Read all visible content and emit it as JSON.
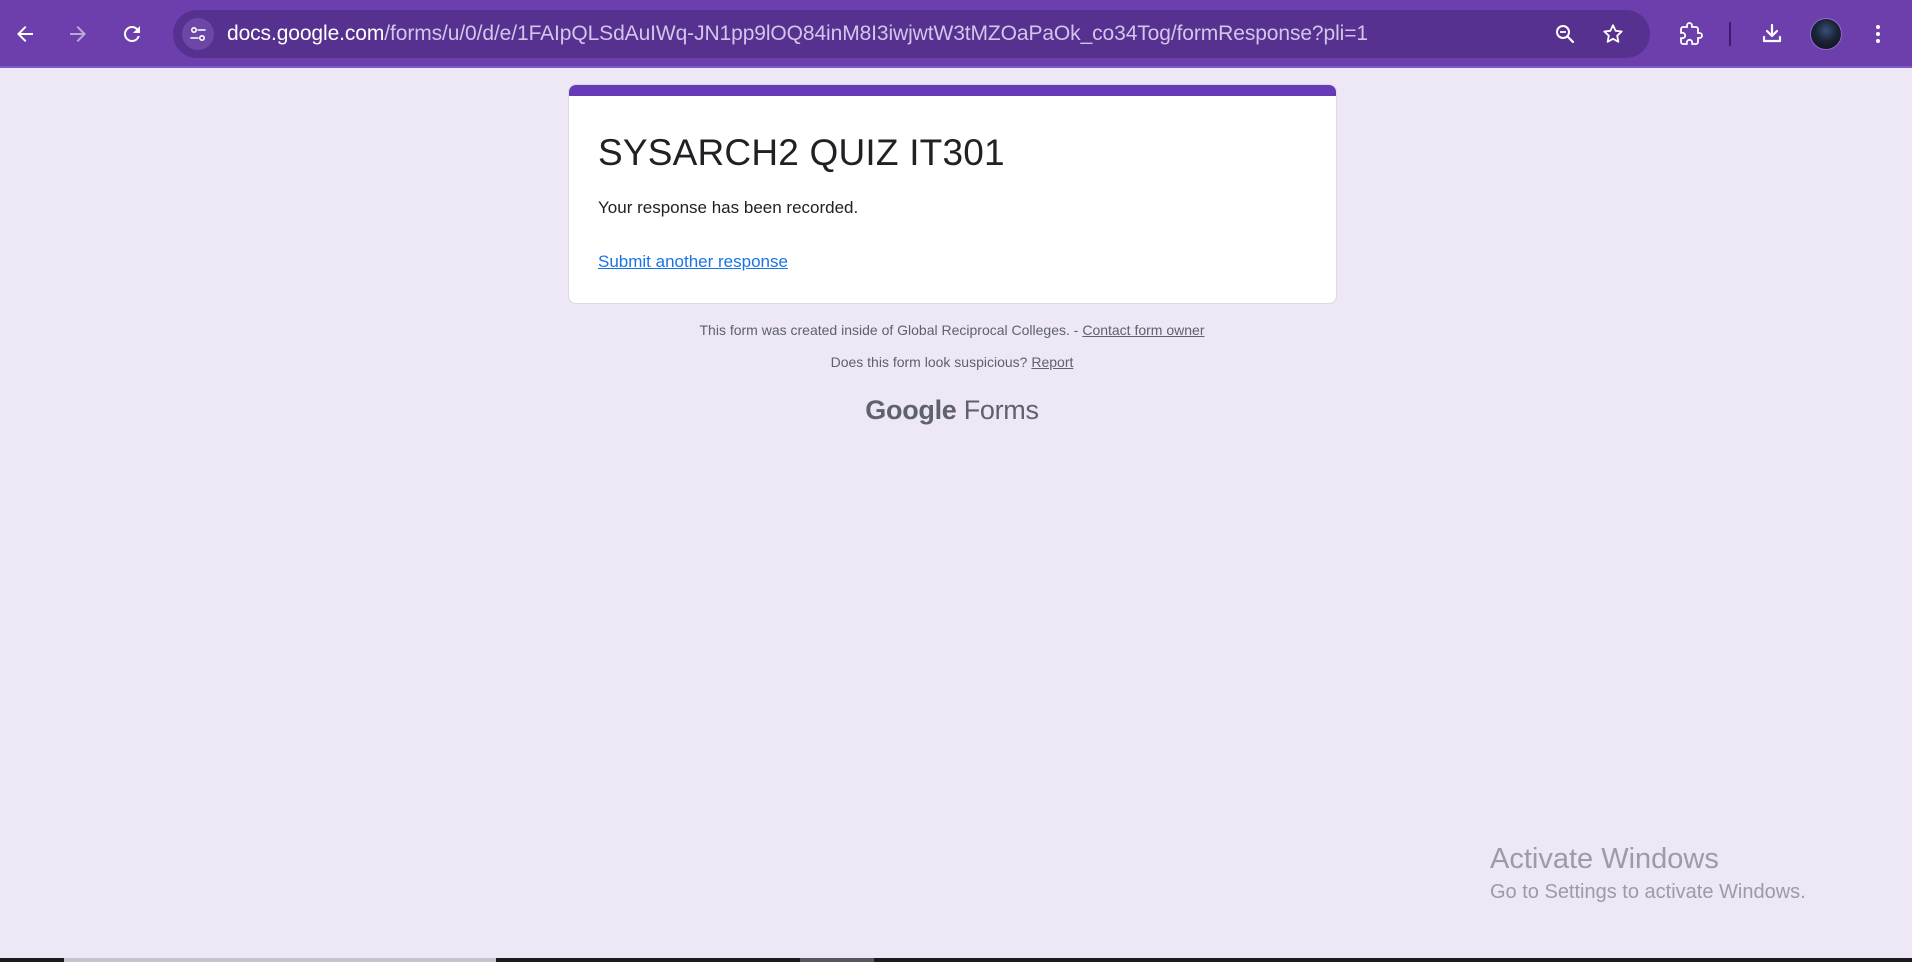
{
  "browser": {
    "url_host": "docs.google.com",
    "url_path": "/forms/u/0/d/e/1FAIpQLSdAuIWq-JN1pp9lOQ84inM8I3iwjwtW3tMZOaPaOk_co34Tog/formResponse?pli=1",
    "icons": {
      "back": "arrow-left-icon",
      "forward": "arrow-right-icon",
      "reload": "reload-icon",
      "site_info": "tune-icon",
      "zoom": "zoom-out-icon",
      "bookmark": "star-icon",
      "extensions": "puzzle-icon",
      "downloads": "download-icon",
      "menu": "more-vert-icon"
    },
    "theme_color": "#6c3fad"
  },
  "form": {
    "title": "SYSARCH2 QUIZ IT301",
    "confirmation": "Your response has been recorded.",
    "submit_another": "Submit another response",
    "accent_color": "#673ab7"
  },
  "footer": {
    "created_text": "This form was created inside of Global Reciprocal Colleges. - ",
    "contact_link": "Contact form owner",
    "suspicious_text": "Does this form look suspicious? ",
    "report_link": "Report",
    "brand_google": "Google",
    "brand_forms": "Forms"
  },
  "watermark": {
    "title": "Activate Windows",
    "subtitle": "Go to Settings to activate Windows."
  }
}
